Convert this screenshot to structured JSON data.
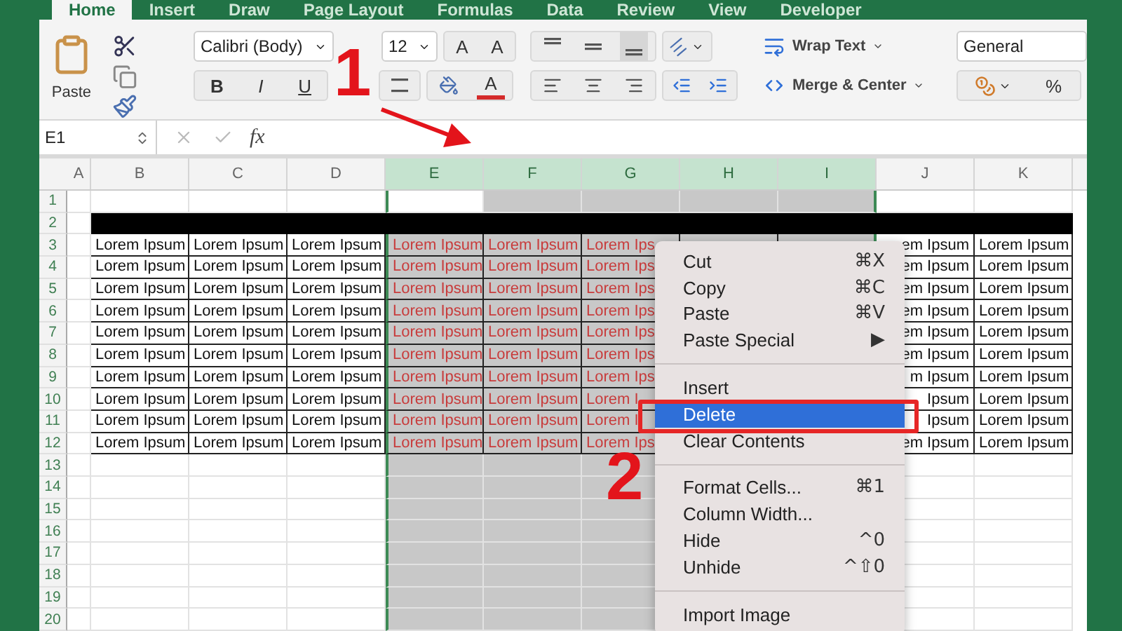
{
  "tabs": [
    {
      "label": "Home",
      "selected": true
    },
    {
      "label": "Insert",
      "selected": false
    },
    {
      "label": "Draw",
      "selected": false
    },
    {
      "label": "Page Layout",
      "selected": false
    },
    {
      "label": "Formulas",
      "selected": false
    },
    {
      "label": "Data",
      "selected": false
    },
    {
      "label": "Review",
      "selected": false
    },
    {
      "label": "View",
      "selected": false
    },
    {
      "label": "Developer",
      "selected": false
    }
  ],
  "ribbon": {
    "paste_label": "Paste",
    "font_name": "Calibri (Body)",
    "font_size": "12",
    "grow_font": "A",
    "shrink_font": "A",
    "bold": "B",
    "italic": "I",
    "underline": "U",
    "font_color": "A",
    "wrap_text": "Wrap Text",
    "merge_center": "Merge & Center",
    "number_format": "General",
    "percent": "%"
  },
  "formula_bar": {
    "name_box": "E1",
    "function_label": "fx"
  },
  "sheet": {
    "columns": [
      {
        "label": "A",
        "selected": false,
        "active": false
      },
      {
        "label": "B",
        "selected": false,
        "active": false
      },
      {
        "label": "C",
        "selected": false,
        "active": false
      },
      {
        "label": "D",
        "selected": false,
        "active": false
      },
      {
        "label": "E",
        "selected": true,
        "active": true
      },
      {
        "label": "F",
        "selected": true,
        "active": false
      },
      {
        "label": "G",
        "selected": true,
        "active": false
      },
      {
        "label": "H",
        "selected": true,
        "active": false
      },
      {
        "label": "I",
        "selected": true,
        "active": false
      },
      {
        "label": "J",
        "selected": false,
        "active": false
      },
      {
        "label": "K",
        "selected": false,
        "active": false
      }
    ],
    "rows": [
      {
        "label": "1",
        "kind": "blank",
        "active": true
      },
      {
        "label": "2",
        "kind": "band"
      },
      {
        "label": "3",
        "kind": "data",
        "cells": [
          "Lorem Ipsum",
          "Lorem Ipsum",
          "Lorem Ipsum",
          "Lorem Ipsum",
          "Lorem Ipsum",
          "Lorem Ips",
          null,
          null,
          "em Ipsum",
          "Lorem Ipsum"
        ]
      },
      {
        "label": "4",
        "kind": "data",
        "cells": [
          "Lorem Ipsum",
          "Lorem Ipsum",
          "Lorem Ipsum",
          "Lorem Ipsum",
          "Lorem Ipsum",
          "Lorem Ips",
          null,
          null,
          "em Ipsum",
          "Lorem Ipsum"
        ]
      },
      {
        "label": "5",
        "kind": "data",
        "cells": [
          "Lorem Ipsum",
          "Lorem Ipsum",
          "Lorem Ipsum",
          "Lorem Ipsum",
          "Lorem Ipsum",
          "Lorem Ips",
          null,
          null,
          "em Ipsum",
          "Lorem Ipsum"
        ]
      },
      {
        "label": "6",
        "kind": "data",
        "cells": [
          "Lorem Ipsum",
          "Lorem Ipsum",
          "Lorem Ipsum",
          "Lorem Ipsum",
          "Lorem Ipsum",
          "Lorem Ips",
          null,
          null,
          "em Ipsum",
          "Lorem Ipsum"
        ]
      },
      {
        "label": "7",
        "kind": "data",
        "cells": [
          "Lorem Ipsum",
          "Lorem Ipsum",
          "Lorem Ipsum",
          "Lorem Ipsum",
          "Lorem Ipsum",
          "Lorem Ips",
          null,
          null,
          "em Ipsum",
          "Lorem Ipsum"
        ]
      },
      {
        "label": "8",
        "kind": "data",
        "cells": [
          "Lorem Ipsum",
          "Lorem Ipsum",
          "Lorem Ipsum",
          "Lorem Ipsum",
          "Lorem Ipsum",
          "Lorem Ips",
          null,
          null,
          "em Ipsum",
          "Lorem Ipsum"
        ]
      },
      {
        "label": "9",
        "kind": "data",
        "cells": [
          "Lorem Ipsum",
          "Lorem Ipsum",
          "Lorem Ipsum",
          "Lorem Ipsum",
          "Lorem Ipsum",
          "Lorem Ips",
          null,
          null,
          "m Ipsum",
          "Lorem Ipsum"
        ]
      },
      {
        "label": "10",
        "kind": "data",
        "cells": [
          "Lorem Ipsum",
          "Lorem Ipsum",
          "Lorem Ipsum",
          "Lorem Ipsum",
          "Lorem Ipsum",
          "Lorem I",
          null,
          null,
          "Ipsum",
          "Lorem Ipsum"
        ]
      },
      {
        "label": "11",
        "kind": "data",
        "cells": [
          "Lorem Ipsum",
          "Lorem Ipsum",
          "Lorem Ipsum",
          "Lorem Ipsum",
          "Lorem Ipsum",
          "Lorem I",
          null,
          null,
          "Ipsum",
          "Lorem Ipsum"
        ]
      },
      {
        "label": "12",
        "kind": "data",
        "cells": [
          "Lorem Ipsum",
          "Lorem Ipsum",
          "Lorem Ipsum",
          "Lorem Ipsum",
          "Lorem Ipsum",
          "Lorem Ips",
          null,
          null,
          "em Ipsum",
          "Lorem Ipsum"
        ]
      },
      {
        "label": "13",
        "kind": "blank"
      },
      {
        "label": "14",
        "kind": "blank"
      },
      {
        "label": "15",
        "kind": "blank"
      },
      {
        "label": "16",
        "kind": "blank"
      },
      {
        "label": "17",
        "kind": "blank"
      },
      {
        "label": "18",
        "kind": "blank"
      },
      {
        "label": "19",
        "kind": "blank"
      },
      {
        "label": "20",
        "kind": "blank"
      }
    ]
  },
  "context_menu": {
    "items": [
      {
        "kind": "item",
        "label": "Cut",
        "shortcut": "⌘X",
        "selected": false
      },
      {
        "kind": "item",
        "label": "Copy",
        "shortcut": "⌘C",
        "selected": false
      },
      {
        "kind": "item",
        "label": "Paste",
        "shortcut": "⌘V",
        "selected": false
      },
      {
        "kind": "item",
        "label": "Paste Special",
        "shortcut": "▶",
        "selected": false
      },
      {
        "kind": "separator"
      },
      {
        "kind": "item",
        "label": "Insert",
        "selected": false
      },
      {
        "kind": "item",
        "label": "Delete",
        "selected": true
      },
      {
        "kind": "item",
        "label": "Clear Contents",
        "selected": false
      },
      {
        "kind": "separator"
      },
      {
        "kind": "item",
        "label": "Format Cells...",
        "shortcut": "⌘1",
        "selected": false
      },
      {
        "kind": "item",
        "label": "Column Width...",
        "selected": false
      },
      {
        "kind": "item",
        "label": "Hide",
        "shortcut": "^0",
        "selected": false
      },
      {
        "kind": "item",
        "label": "Unhide",
        "shortcut": "^⇧0",
        "selected": false
      },
      {
        "kind": "separator"
      },
      {
        "kind": "item",
        "label": "Import Image",
        "selected": false
      }
    ]
  },
  "annotations": [
    {
      "kind": "step",
      "text": "1"
    },
    {
      "kind": "step",
      "text": "2"
    }
  ]
}
